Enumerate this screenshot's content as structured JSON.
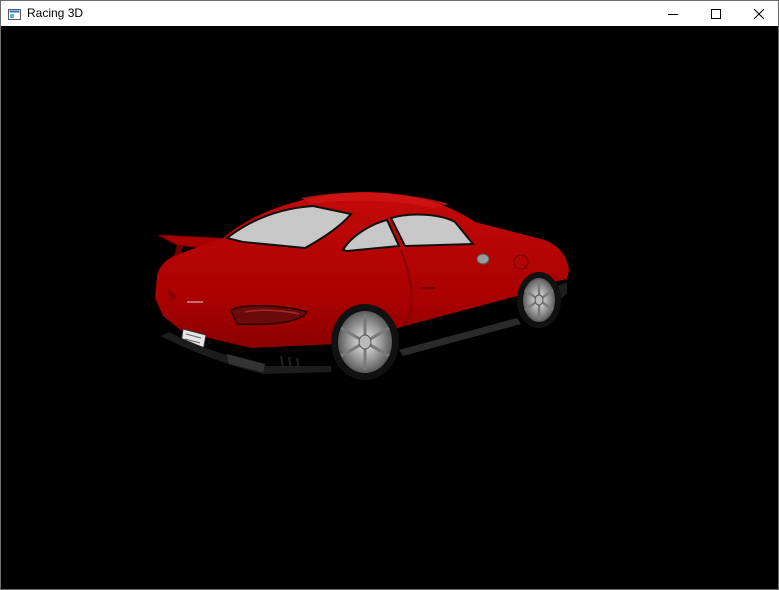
{
  "window": {
    "title": "Racing 3D",
    "app_icon": "window-app-icon",
    "controls": {
      "minimize_icon": "minimize-icon",
      "maximize_icon": "maximize-icon",
      "close_icon": "close-icon"
    }
  },
  "scene": {
    "background_color": "#000000",
    "car_body_color": "#b30000",
    "window_glass_color": "#c8c8c8"
  }
}
